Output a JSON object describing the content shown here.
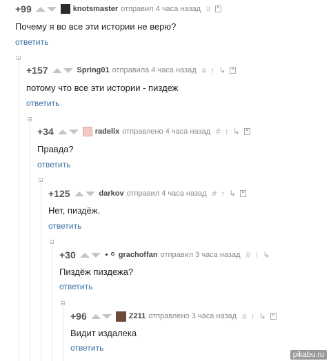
{
  "comments": [
    {
      "score": "+99",
      "user": "knotsmaster",
      "meta": "отправил 4 часа назад",
      "text": "Почему я во все эти истории не верю?",
      "reply": "ответить"
    },
    {
      "score": "+157",
      "user": "Spring01",
      "meta": "отправила 4 часа назад",
      "text": "потому что все эти истории - пиздеж",
      "reply": "ответить"
    },
    {
      "score": "+34",
      "user": "radelix",
      "meta": "отправлено 4 часа назад",
      "text": "Правда?",
      "reply": "ответить"
    },
    {
      "score": "+125",
      "user": "darkov",
      "meta": "отправил 4 часа назад",
      "text": "Нет, пиздёж.",
      "reply": "ответить"
    },
    {
      "score": "+30",
      "user": "grachoffan",
      "meta": "отправил 3 часа назад",
      "text": "Пиздёж пиздежа?",
      "reply": "ответить"
    },
    {
      "score": "+96",
      "user": "Z211",
      "meta": "отправлено 3 часа назад",
      "text": "Видит издалека",
      "reply": "ответить"
    }
  ],
  "tool_icons": [
    "hash-icon",
    "up-arrow-icon",
    "tree-icon",
    "save-icon"
  ],
  "colors": {
    "reply_link": "#3b70a5",
    "score": "#555555",
    "meta": "#888888",
    "thread_line": "#e2e2e2"
  },
  "watermark": "pikabu.ru"
}
